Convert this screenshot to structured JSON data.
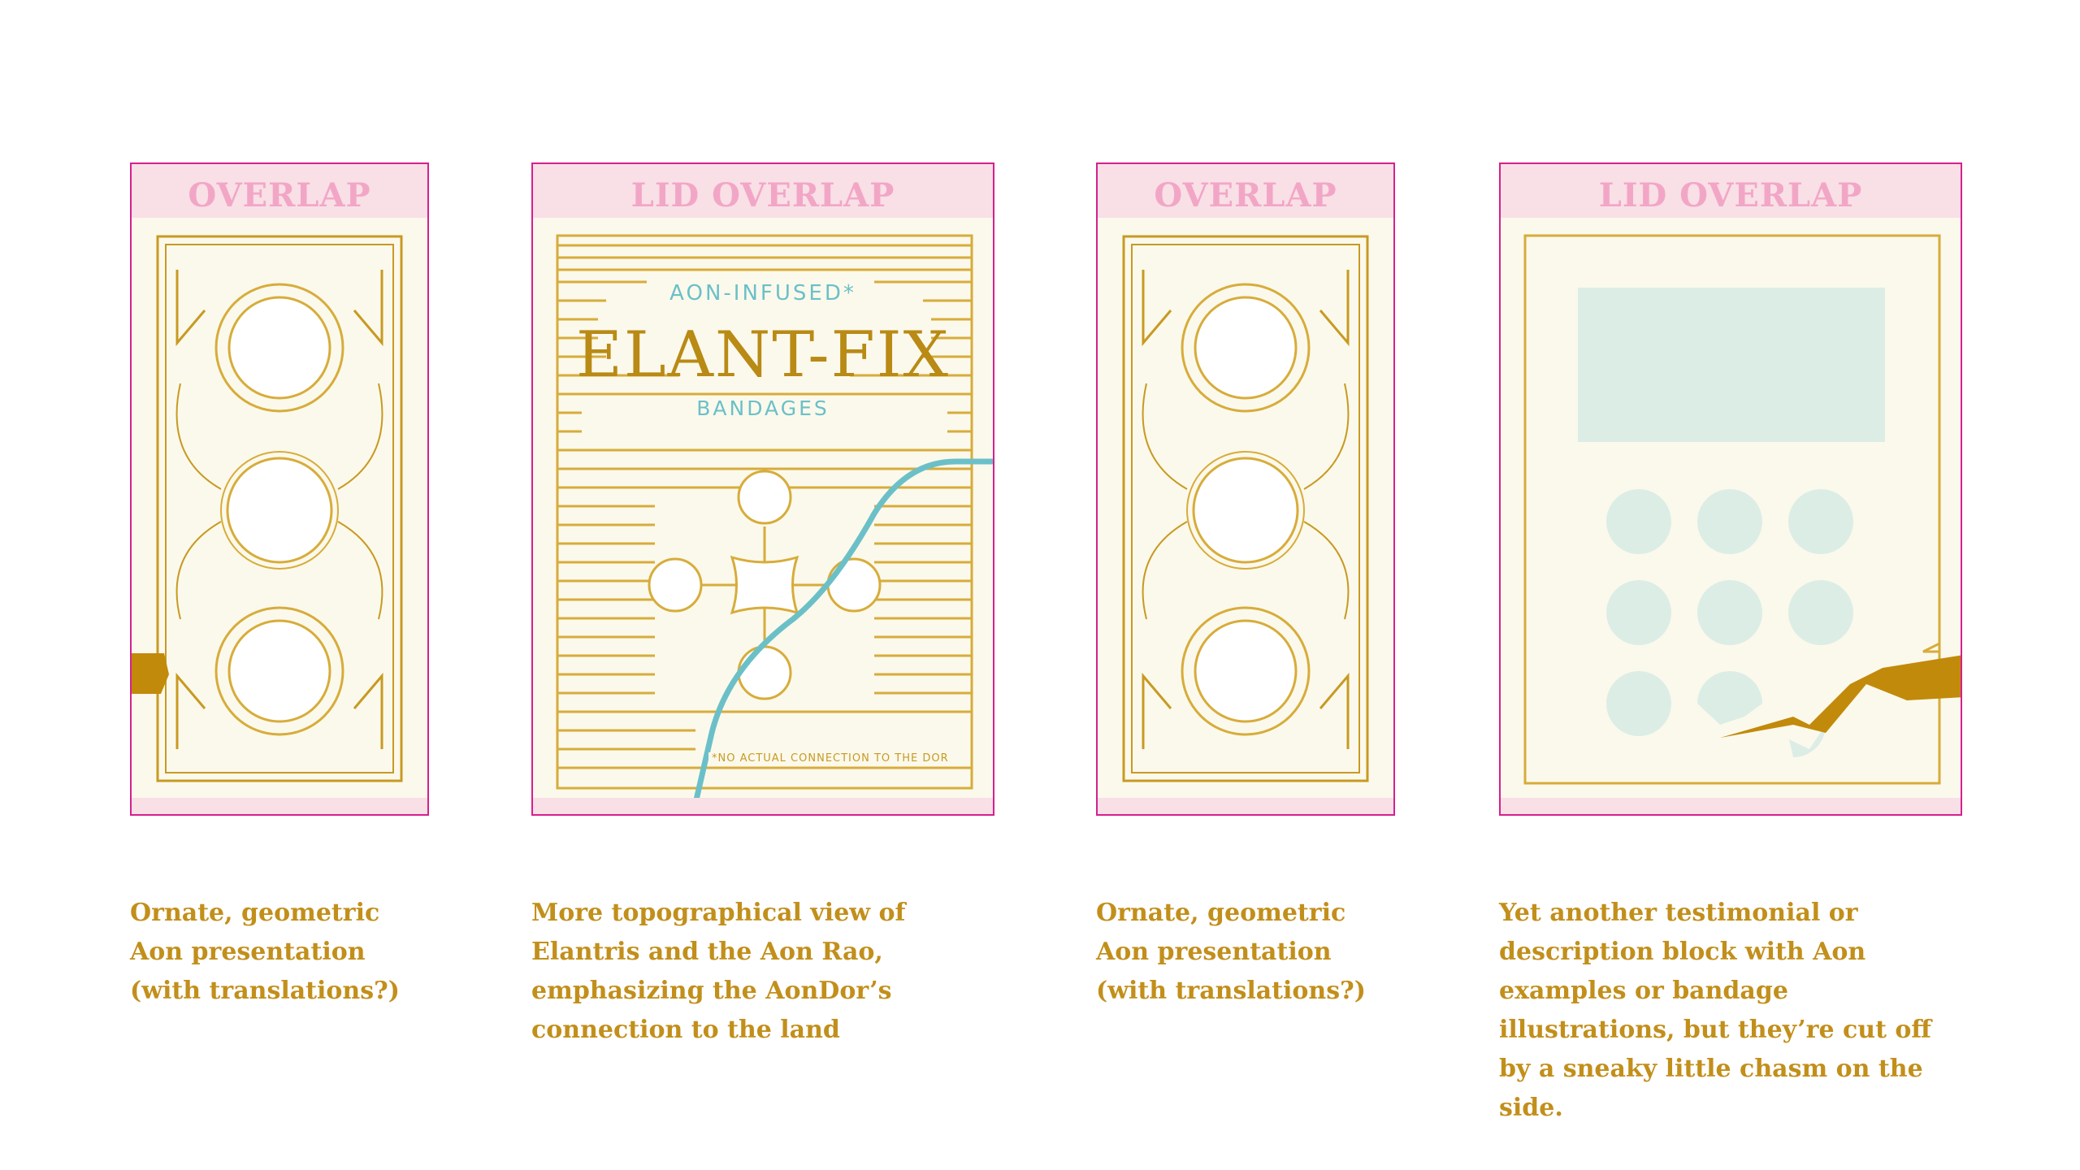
{
  "panels": [
    {
      "band_label": "OVERLAP",
      "caption": "Ornate, geometric Aon presentation (with translations?)"
    },
    {
      "band_label": "LID OVERLAP",
      "kicker": "AON-INFUSED*",
      "title": "ELANT-FIX",
      "subtitle": "BANDAGES",
      "footnote": "*NO ACTUAL CONNECTION TO THE DOR",
      "caption": "More topographical view of Elantris and the Aon Rao, emphasizing the AonDor’s connection to the land"
    },
    {
      "band_label": "OVERLAP",
      "caption": "Ornate, geometric Aon presentation (with translations?)"
    },
    {
      "band_label": "LID OVERLAP",
      "caption": "Yet another testimonial or description block with Aon examples or bandage illustrations, but they’re cut off by a sneaky little chasm on the side."
    }
  ],
  "colors": {
    "border": "#d6208e",
    "band": "#f9dfe6",
    "band_text": "#f2a6c6",
    "paper": "#fbf9ec",
    "gold": "#c89a22",
    "gold_dark": "#b8860b",
    "teal": "#6bc0c8",
    "mint": "#dcede6",
    "caption": "#c28f1b"
  }
}
